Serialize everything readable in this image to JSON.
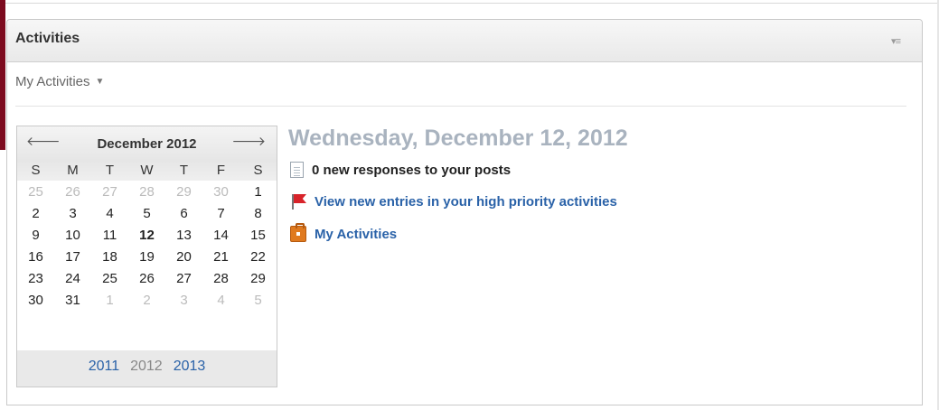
{
  "panel": {
    "title": "Activities",
    "menu_icon": "menu-icon"
  },
  "subnav": {
    "label": "My Activities",
    "caret_icon": "caret-down-icon"
  },
  "calendar": {
    "month_label": "December 2012",
    "prev_icon": "arrow-left-icon",
    "next_icon": "arrow-right-icon",
    "weekdays": [
      "S",
      "M",
      "T",
      "W",
      "T",
      "F",
      "S"
    ],
    "weeks": [
      [
        "25",
        "26",
        "27",
        "28",
        "29",
        "30",
        "1"
      ],
      [
        "2",
        "3",
        "4",
        "5",
        "6",
        "7",
        "8"
      ],
      [
        "9",
        "10",
        "11",
        "12",
        "13",
        "14",
        "15"
      ],
      [
        "16",
        "17",
        "18",
        "19",
        "20",
        "21",
        "22"
      ],
      [
        "23",
        "24",
        "25",
        "26",
        "27",
        "28",
        "29"
      ],
      [
        "30",
        "31",
        "1",
        "2",
        "3",
        "4",
        "5"
      ]
    ],
    "today": "12",
    "years": [
      "2011",
      "2012",
      "2013"
    ],
    "current_year": "2012"
  },
  "main": {
    "date_title": "Wednesday, December 12, 2012",
    "items": [
      {
        "icon": "document-icon",
        "text": "0 new responses to your posts",
        "link": false
      },
      {
        "icon": "flag-icon",
        "text": "View new entries in your high priority activities",
        "link": true
      },
      {
        "icon": "briefcase-icon",
        "text": "My Activities",
        "link": true
      }
    ]
  },
  "colors": {
    "accent": "#7d0b1f",
    "link": "#2a62a8",
    "date_title": "#a9b3bf"
  }
}
